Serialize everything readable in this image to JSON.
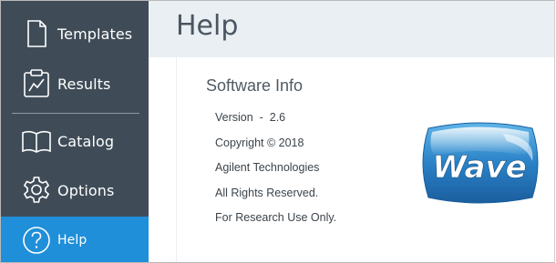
{
  "sidebar": {
    "items": [
      {
        "label": "Templates",
        "icon": "document-icon",
        "active": false
      },
      {
        "label": "Results",
        "icon": "chart-document-icon",
        "active": false
      },
      {
        "label": "Catalog",
        "icon": "open-book-icon",
        "active": false
      },
      {
        "label": "Options",
        "icon": "gear-icon",
        "active": false
      },
      {
        "label": "Help",
        "icon": "question-circle-icon",
        "active": true
      }
    ]
  },
  "header": {
    "title": "Help"
  },
  "software_info": {
    "title": "Software Info",
    "lines": [
      "Version  -  2.6",
      "Copyright © 2018",
      "Agilent Technologies",
      "All Rights Reserved.",
      "For Research Use Only."
    ]
  },
  "logo": {
    "text": "Wave"
  },
  "colors": {
    "sidebar_bg": "#3f4c58",
    "active_bg": "#1f8fd9",
    "header_bg": "#e9eff3",
    "logo_blue": "#2a82c7"
  }
}
